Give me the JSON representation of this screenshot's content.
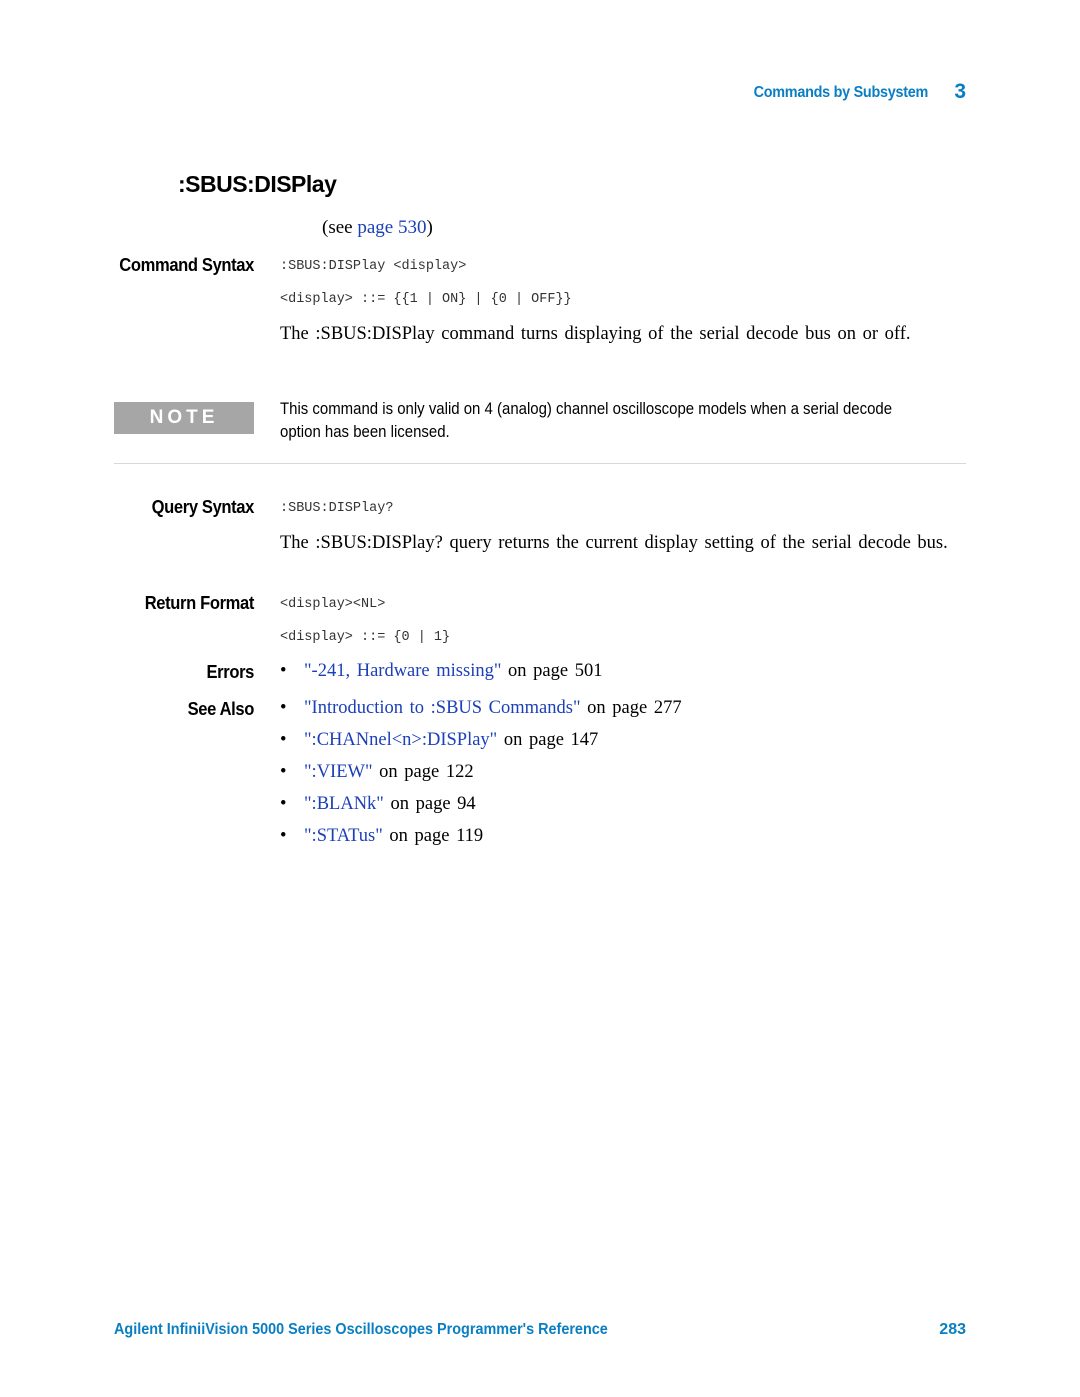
{
  "header": {
    "chapter_title": "Commands by Subsystem",
    "chapter_number": "3"
  },
  "title": ":SBUS:DISPlay",
  "see_page": {
    "prefix": "(see",
    "link_label": "page",
    "link_number": "530",
    "suffix": ")"
  },
  "command_syntax": {
    "label": "Command Syntax",
    "lines": [
      ":SBUS:DISPlay <display>",
      "<display> ::= {{1 | ON} | {0 | OFF}}"
    ],
    "description": "The :SBUS:DISPlay command turns displaying of the serial decode bus on or off."
  },
  "note": {
    "badge": "NOTE",
    "text_line1": "This command is only valid on 4 (analog) channel oscilloscope models when a serial decode",
    "text_line2": "option has been licensed."
  },
  "query_syntax": {
    "label": "Query Syntax",
    "line": ":SBUS:DISPlay?",
    "description": "The :SBUS:DISPlay? query returns the current display setting of the serial decode bus."
  },
  "return_format": {
    "label": "Return Format",
    "lines": [
      "<display><NL>",
      "<display> ::= {0 | 1}"
    ]
  },
  "errors": {
    "label": "Errors",
    "items": [
      {
        "link": "\"-241, Hardware missing\"",
        "suffix": "on page 501"
      }
    ]
  },
  "see_also": {
    "label": "See Also",
    "items": [
      {
        "link": "\"Introduction to :SBUS Commands\"",
        "suffix": "on page 277"
      },
      {
        "link": "\":CHANnel<n>:DISPlay\"",
        "suffix": "on page 147"
      },
      {
        "link": "\":VIEW\"",
        "suffix": "on page 122"
      },
      {
        "link": "\":BLANk\"",
        "suffix": "on page 94"
      },
      {
        "link": "\":STATus\"",
        "suffix": "on page 119"
      }
    ]
  },
  "bullet_glyph": "•",
  "footer": {
    "title": "Agilent InfiniiVision 5000 Series Oscilloscopes Programmer's Reference",
    "page": "283"
  },
  "colors": {
    "accent_blue": "#0a7ec2",
    "link_blue": "#1a3fb8",
    "note_gray": "#a6a6a6"
  }
}
